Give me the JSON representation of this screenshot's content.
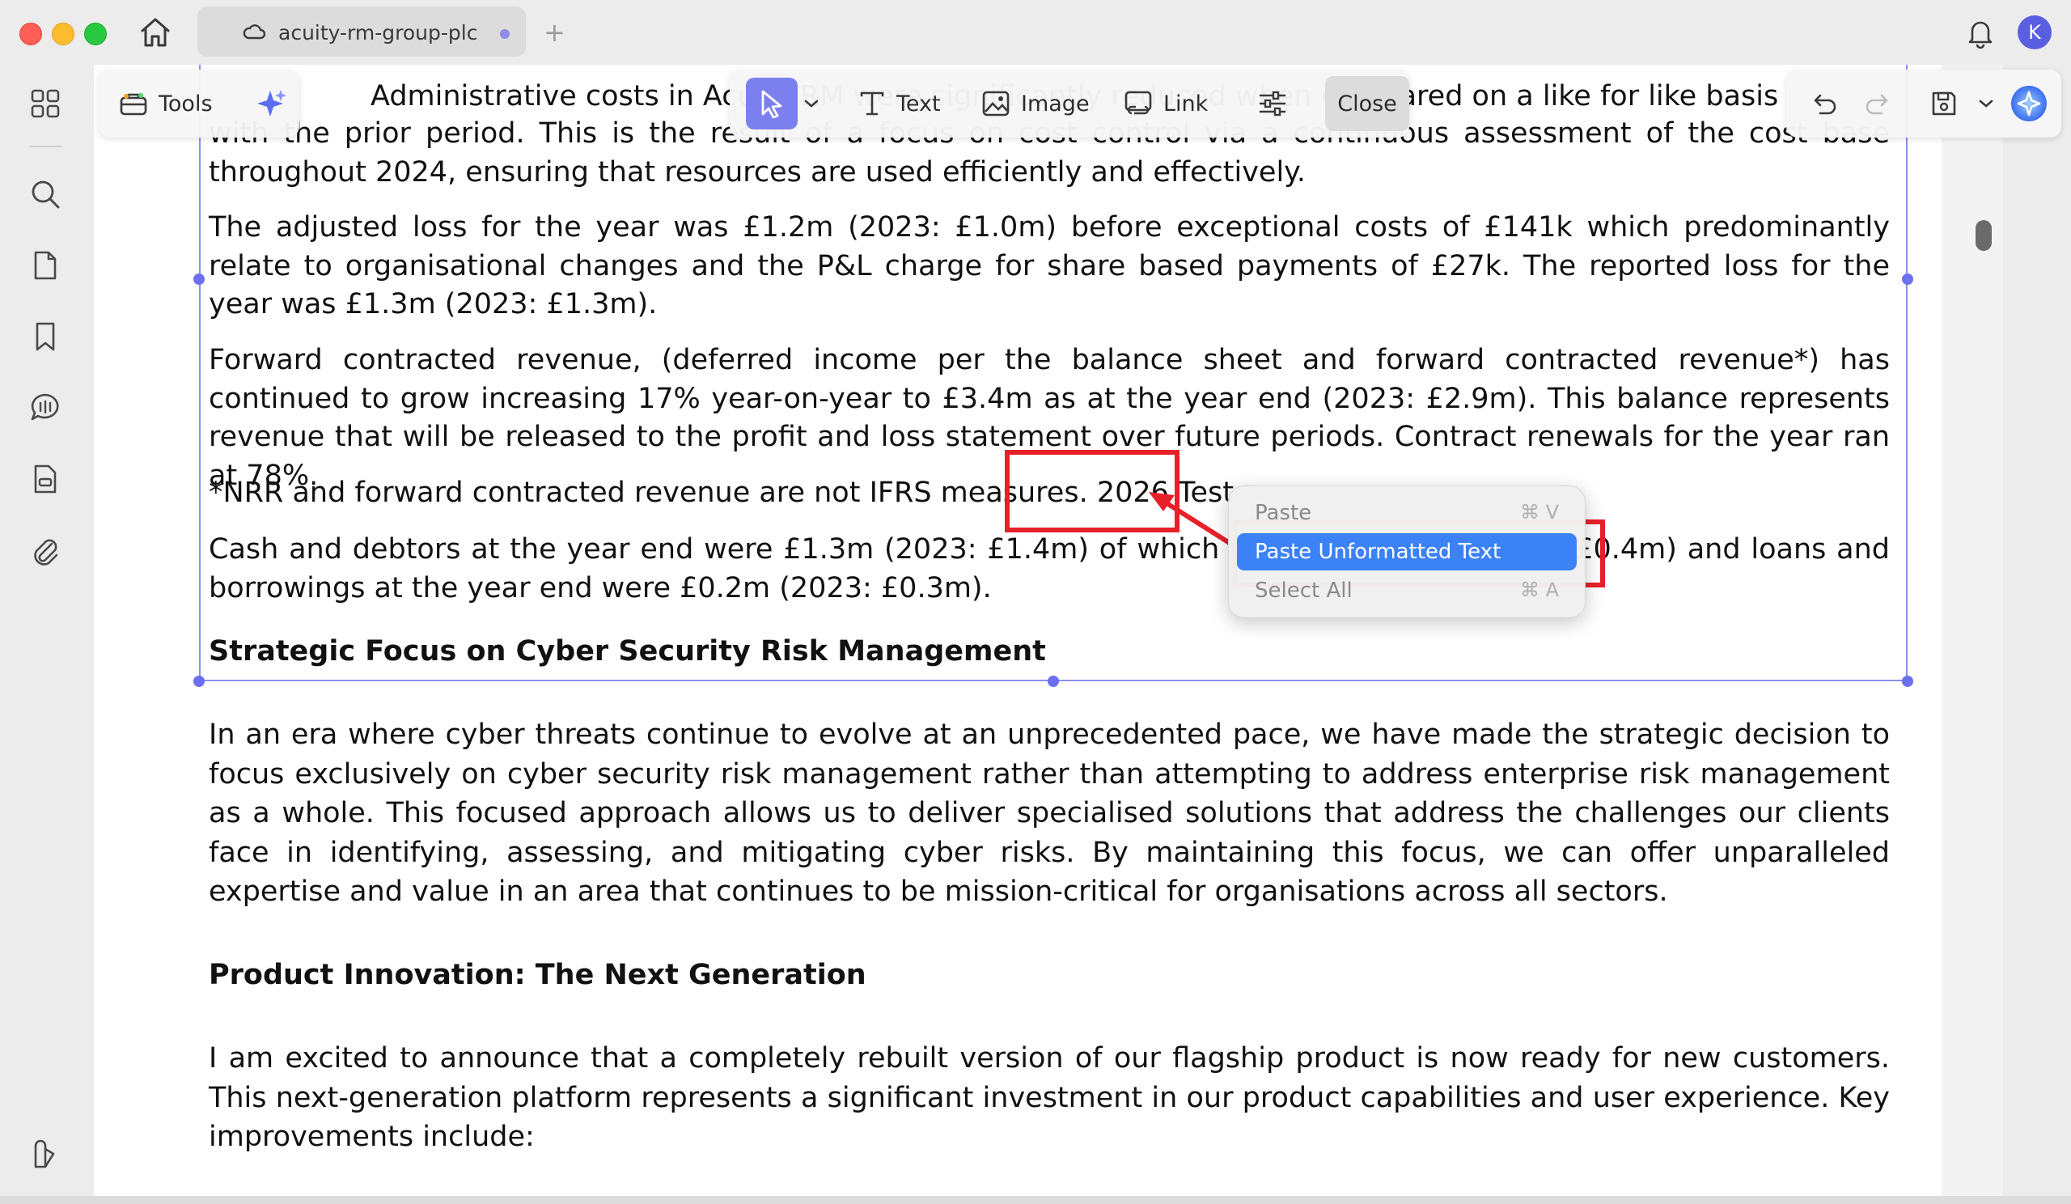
{
  "window": {
    "tab_title": "acuity-rm-group-plc",
    "new_tab_symbol": "+",
    "avatar_initial": "K"
  },
  "toolbar": {
    "tools_label": "Tools",
    "text_label": "Text",
    "image_label": "Image",
    "link_label": "Link",
    "close_label": "Close"
  },
  "document": {
    "p1_line1": "Administrative costs in Acuity RM were significantly reduced when compared on a like for like basis",
    "p1": "with the prior period. This is the result of a focus on cost control via a continuous assessment of the cost base throughout 2024, ensuring that resources are used efficiently and effectively.",
    "p2": "The adjusted loss for the year was £1.2m (2023: £1.0m) before exceptional costs of £141k which predominantly relate to organisational changes and the P&L charge for share based payments of £27k. The reported loss for the year was £1.3m (2023: £1.3m).",
    "p3": "Forward contracted revenue, (deferred income per the balance sheet and forward contracted revenue*) has continued to grow increasing 17% year-on-year to £3.4m as at the year end (2023: £2.9m). This balance represents revenue that will be released to the profit and loss statement over future periods. Contract renewals for the year ran at 78%.",
    "p4": "*NRR and forward contracted revenue are not IFRS measures. 2026 Test",
    "p5": "Cash and debtors at the year end were £1.3m (2023: £1.4m) of which cash was £0.3m (2023: £0.4m) and loans and borrowings at the year end were £0.2m (2023: £0.3m).",
    "h1": "Strategic Focus on Cyber Security Risk Management",
    "p6": "In an era where cyber threats continue to evolve at an unprecedented pace, we have made the strategic decision to focus exclusively on cyber security risk management rather than attempting to address enterprise risk management as a whole. This focused approach allows us to deliver specialised solutions that address the challenges our clients face in identifying, assessing, and mitigating cyber risks. By maintaining this focus, we can offer unparalleled expertise and value in an area that continues to be mission-critical for organisations across all sectors.",
    "h2": "Product Innovation: The Next Generation",
    "p7": "I am excited to announce that a completely rebuilt version of our flagship product is now ready for new customers. This next-generation platform represents a significant investment in our product capabilities and user experience. Key improvements include:"
  },
  "context_menu": {
    "items": [
      {
        "label": "Paste",
        "shortcut": "⌘ V"
      },
      {
        "label": "Paste Unformatted Text",
        "shortcut": ""
      },
      {
        "label": "Select All",
        "shortcut": "⌘ A"
      }
    ]
  },
  "colors": {
    "accent": "#7c80ee",
    "selection_border": "#8b8ff0",
    "annotation_red": "#e8202a",
    "menu_highlight": "#3b82f6"
  }
}
